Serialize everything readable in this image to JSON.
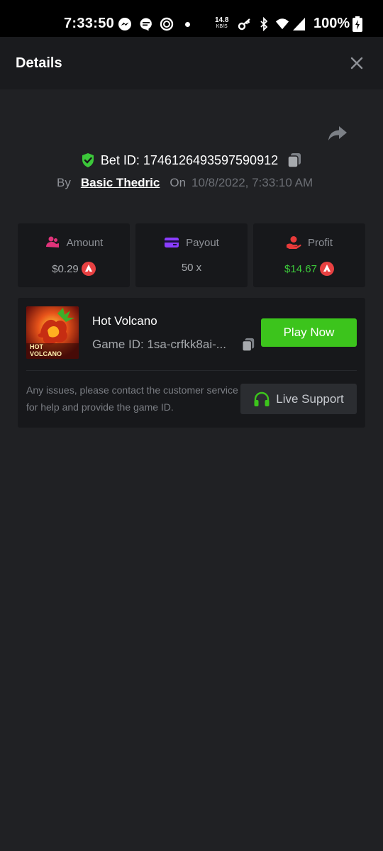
{
  "status_bar": {
    "time": "7:33:50",
    "net_speed": "14.8",
    "net_unit": "KB/S",
    "battery": "100%"
  },
  "header": {
    "title": "Details"
  },
  "bet": {
    "id_label": "Bet ID: 1746126493597590912",
    "by_label": "By",
    "user": "Basic Thedric",
    "on_label": "On",
    "date": "10/8/2022, 7:33:10 AM"
  },
  "stats": {
    "amount": {
      "label": "Amount",
      "value": "$0.29"
    },
    "payout": {
      "label": "Payout",
      "value": "50 x"
    },
    "profit": {
      "label": "Profit",
      "value": "$14.67"
    }
  },
  "game": {
    "title": "Hot Volcano",
    "id": "Game ID: 1sa-crfkk8ai-...",
    "thumb_text_1": "HOT",
    "thumb_text_2": "VOLCANO",
    "play_label": "Play Now",
    "issue_text": "Any issues, please contact the customer service for help and provide the game ID.",
    "support_label": "Live Support"
  },
  "colors": {
    "accent_green": "#3cc41c",
    "profit_green": "#3cc83a",
    "coin_red": "#e84142",
    "amount_pink": "#e0337a",
    "payout_purple": "#8b3dff",
    "profit_red": "#e83a3a"
  },
  "icons": [
    "messenger-icon",
    "chat-icon",
    "sync-icon",
    "key-icon",
    "bluetooth-icon",
    "wifi-icon",
    "signal-icon",
    "battery-icon",
    "close-icon",
    "share-icon",
    "shield-check-icon",
    "copy-icon",
    "coins-icon",
    "card-icon",
    "hand-coin-icon",
    "avalanche-coin-icon",
    "headset-icon"
  ]
}
